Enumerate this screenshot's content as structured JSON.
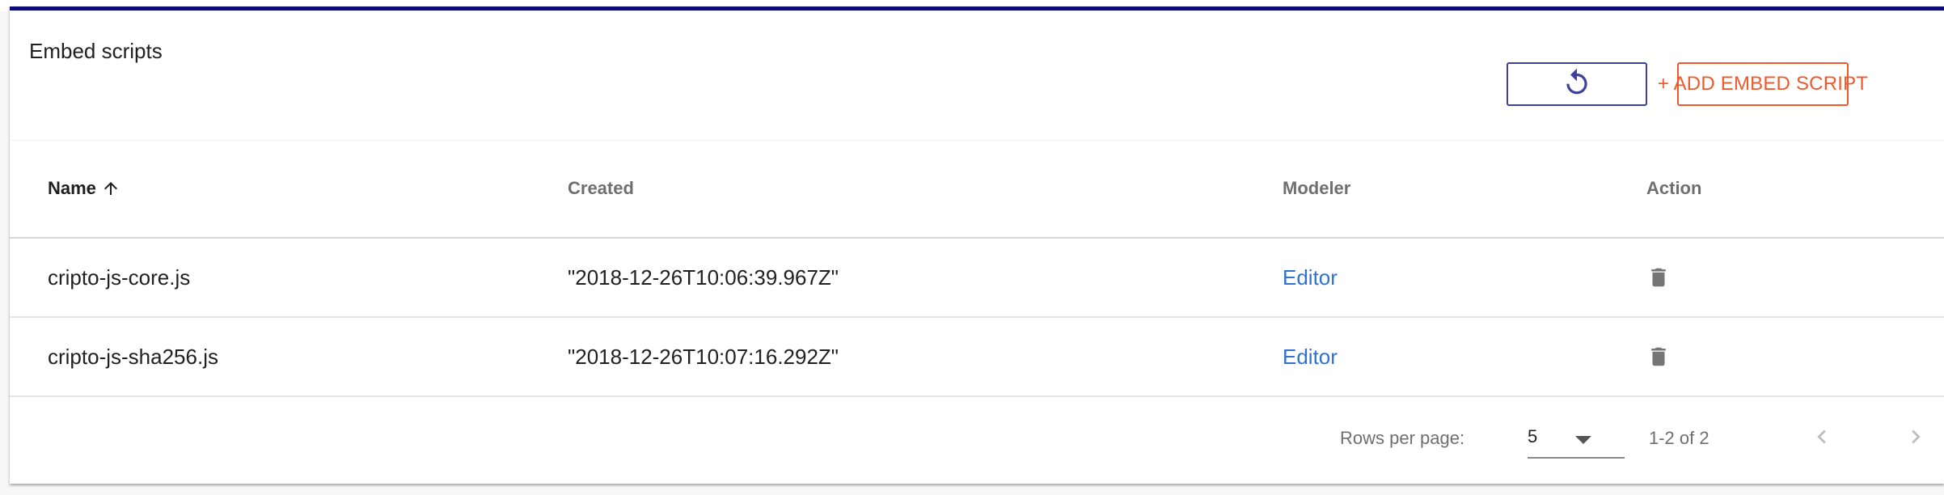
{
  "card": {
    "title": "Embed scripts",
    "refresh_icon": "refresh-icon",
    "add_button_label": "+ ADD EMBED SCRIPT"
  },
  "table": {
    "headers": {
      "name": "Name",
      "created": "Created",
      "modeler": "Modeler",
      "action": "Action"
    },
    "sort_icon": "arrow-up-icon",
    "rows": [
      {
        "name": "cripto-js-core.js",
        "created": "\"2018-12-26T10:06:39.967Z\"",
        "modeler": "Editor",
        "action_icon": "trash-icon"
      },
      {
        "name": "cripto-js-sha256.js",
        "created": "\"2018-12-26T10:07:16.292Z\"",
        "modeler": "Editor",
        "action_icon": "trash-icon"
      }
    ]
  },
  "pagination": {
    "rows_per_page_label": "Rows per page:",
    "rows_per_page_value": "5",
    "range_label": "1-2 of 2",
    "prev_icon": "chevron-left-icon",
    "next_icon": "chevron-right-icon"
  },
  "colors": {
    "accent": "#0d0a7a",
    "primary_button": "#3f3fa0",
    "add_button": "#ef5a2c",
    "link": "#2c73d2"
  }
}
